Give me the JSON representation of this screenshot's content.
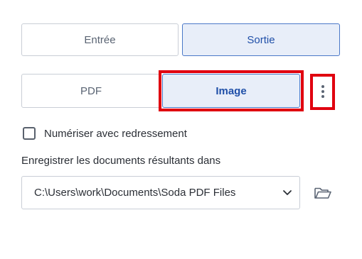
{
  "direction_tabs": {
    "input_label": "Entrée",
    "output_label": "Sortie"
  },
  "format_tabs": {
    "pdf_label": "PDF",
    "image_label": "Image"
  },
  "options": {
    "more_icon": "vertical-ellipsis-icon",
    "deskew_label": "Numériser avec redressement",
    "deskew_checked": false
  },
  "save_location": {
    "label": "Enregistrer les documents résultants dans",
    "selected_path": "C:\\Users\\work\\Documents\\Soda PDF Files",
    "dropdown_icon": "chevron-down-icon",
    "browse_icon": "folder-open-icon"
  },
  "colors": {
    "accent": "#1f4fa8",
    "selected_bg": "#e8eef9",
    "highlight": "#e0000f"
  }
}
